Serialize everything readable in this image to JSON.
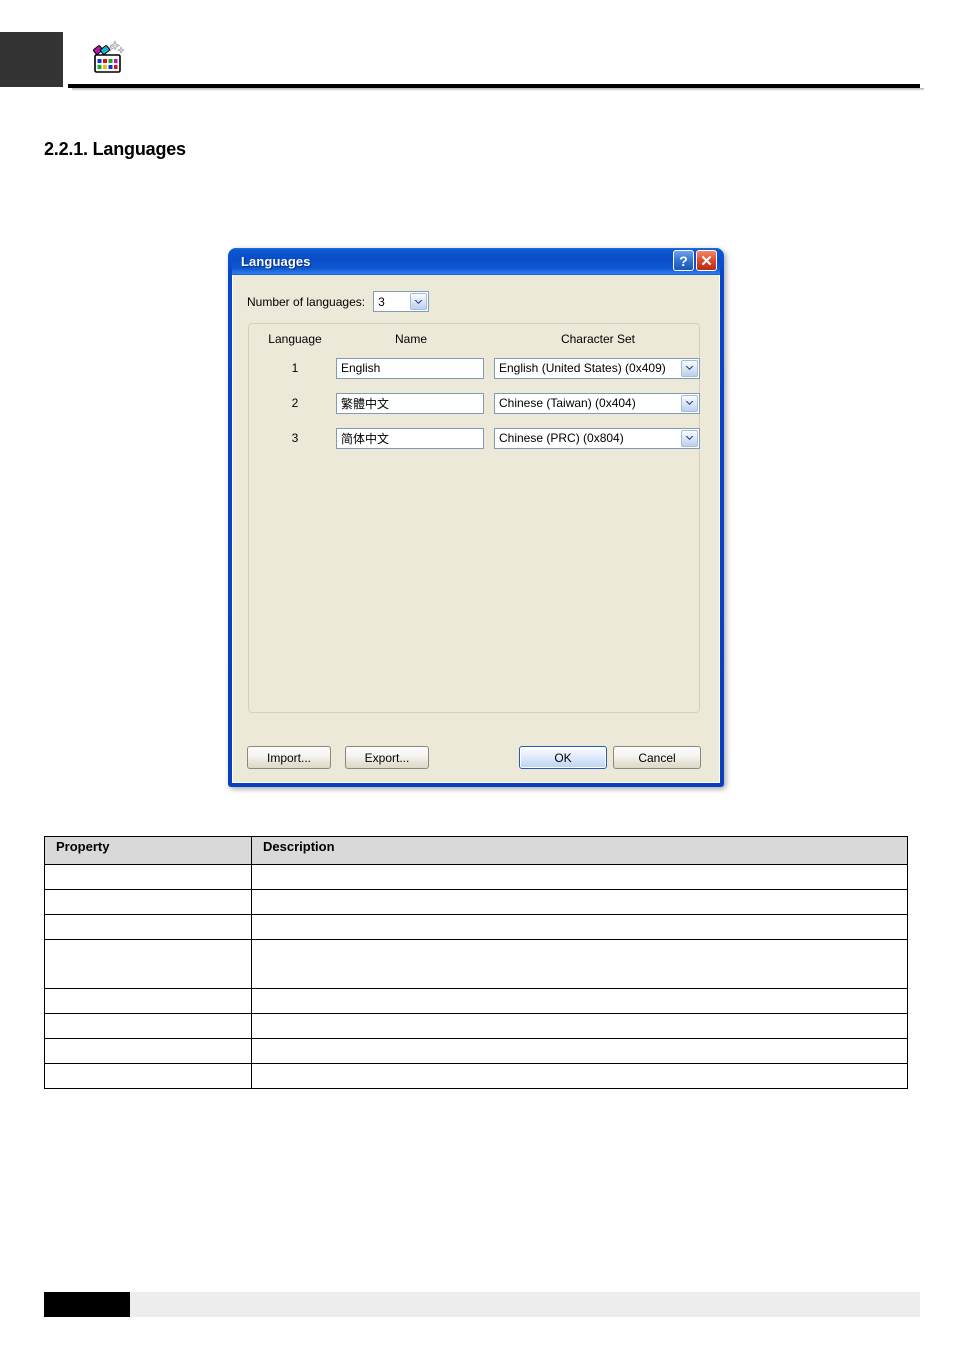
{
  "page": {
    "section_number": "2.2.1.",
    "section_title": "Languages",
    "heading": "2.2.1. Languages",
    "header_icon": "color-palette-wand-icon"
  },
  "dialog": {
    "title": "Languages",
    "help_button": "?",
    "close_button": "✕",
    "help_icon_name": "help-icon",
    "close_icon_name": "close-icon",
    "number_of_languages": {
      "label": "Number of languages:",
      "value": "3"
    },
    "grid": {
      "headers": {
        "language": "Language",
        "name": "Name",
        "character_set": "Character Set"
      },
      "rows": [
        {
          "index": "1",
          "name": "English",
          "character_set": "English (United States) (0x409)"
        },
        {
          "index": "2",
          "name": "繁體中文",
          "character_set": "Chinese (Taiwan) (0x404)"
        },
        {
          "index": "3",
          "name": "简体中文",
          "character_set": "Chinese (PRC) (0x804)"
        }
      ]
    },
    "buttons": {
      "import": "Import...",
      "export": "Export...",
      "ok": "OK",
      "cancel": "Cancel"
    },
    "colors": {
      "titlebar_blue": "#0a46c8",
      "dialog_face": "#ece9d8",
      "field_border": "#7f9db9",
      "default_button_border": "#2b5ba8"
    }
  },
  "property_table": {
    "headers": {
      "property": "Property",
      "description": "Description"
    },
    "rows": [
      {
        "property": "",
        "description": "",
        "tall": false
      },
      {
        "property": "",
        "description": "",
        "tall": false
      },
      {
        "property": "",
        "description": "",
        "tall": false
      },
      {
        "property": "",
        "description": "",
        "tall": true
      },
      {
        "property": "",
        "description": "",
        "tall": false
      },
      {
        "property": "",
        "description": "",
        "tall": false
      },
      {
        "property": "",
        "description": "",
        "tall": false
      },
      {
        "property": "",
        "description": "",
        "tall": false
      }
    ]
  }
}
